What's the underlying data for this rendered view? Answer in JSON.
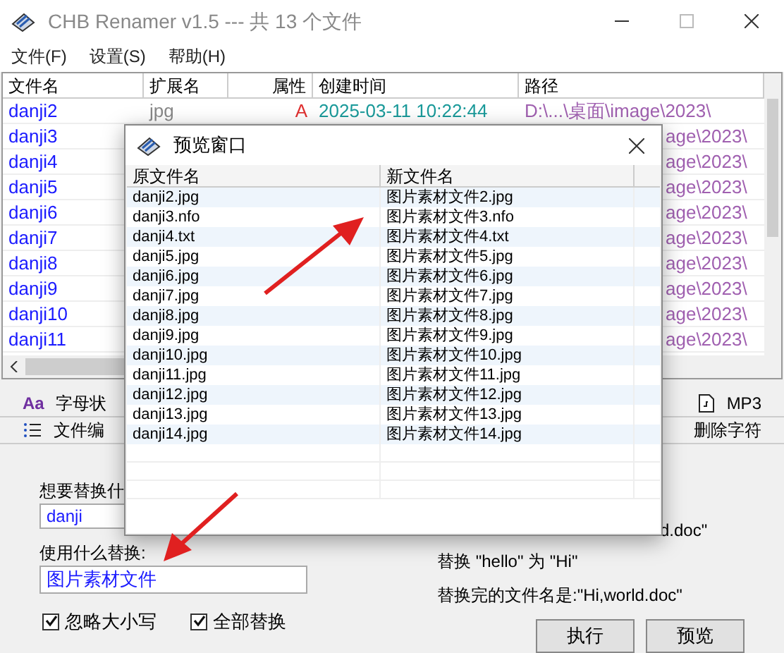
{
  "window": {
    "title": "CHB Renamer v1.5 --- 共 13 个文件"
  },
  "menu": [
    "文件(F)",
    "设置(S)",
    "帮助(H)"
  ],
  "file_list": {
    "columns": [
      "文件名",
      "扩展名",
      "属性",
      "创建时间",
      "路径"
    ],
    "rows": [
      {
        "name": "danji2",
        "ext": "jpg",
        "attr": "A",
        "created": "2025-03-11 10:22:44",
        "path": "D:\\...\\桌面\\image\\2023\\"
      },
      {
        "name": "danji3",
        "path": "age\\2023\\"
      },
      {
        "name": "danji4",
        "path": "age\\2023\\"
      },
      {
        "name": "danji5",
        "path": "age\\2023\\"
      },
      {
        "name": "danji6",
        "path": "age\\2023\\"
      },
      {
        "name": "danji7",
        "path": "age\\2023\\"
      },
      {
        "name": "danji8",
        "path": "age\\2023\\"
      },
      {
        "name": "danji9",
        "path": "age\\2023\\"
      },
      {
        "name": "danji10",
        "path": "age\\2023\\"
      },
      {
        "name": "danji11",
        "path": "age\\2023\\"
      }
    ]
  },
  "tabs_row1": [
    {
      "label": "字母状",
      "kind": "letters",
      "icon_text": "Aa",
      "selected": false
    },
    {
      "label": "MP3",
      "kind": "file",
      "selected": false
    }
  ],
  "tabs_row2": [
    {
      "label": "文件编",
      "kind": "list",
      "selected": false
    },
    {
      "label": "删除字符",
      "kind": "plain",
      "selected": false
    }
  ],
  "replace_panel": {
    "find_label": "想要替换什",
    "find_value": "danji",
    "replace_label": "使用什么替换:",
    "replace_value": "图片素材文件",
    "example_cut": "d.doc\"",
    "example_1": "替换 \"hello\" 为 \"Hi\"",
    "example_2": "替换完的文件名是:\"Hi,world.doc\"",
    "options": [
      {
        "label": "忽略大小写",
        "checked": true
      },
      {
        "label": "全部替换",
        "checked": true
      }
    ],
    "buttons": [
      "执行",
      "预览"
    ]
  },
  "preview_dialog": {
    "title": "预览窗口",
    "columns": [
      "原文件名",
      "新文件名"
    ],
    "rows": [
      [
        "danji2.jpg",
        "图片素材文件2.jpg"
      ],
      [
        "danji3.nfo",
        "图片素材文件3.nfo"
      ],
      [
        "danji4.txt",
        "图片素材文件4.txt"
      ],
      [
        "danji5.jpg",
        "图片素材文件5.jpg"
      ],
      [
        "danji6.jpg",
        "图片素材文件6.jpg"
      ],
      [
        "danji7.jpg",
        "图片素材文件7.jpg"
      ],
      [
        "danji8.jpg",
        "图片素材文件8.jpg"
      ],
      [
        "danji9.jpg",
        "图片素材文件9.jpg"
      ],
      [
        "danji10.jpg",
        "图片素材文件10.jpg"
      ],
      [
        "danji11.jpg",
        "图片素材文件11.jpg"
      ],
      [
        "danji12.jpg",
        "图片素材文件12.jpg"
      ],
      [
        "danji13.jpg",
        "图片素材文件13.jpg"
      ],
      [
        "danji14.jpg",
        "图片素材文件14.jpg"
      ]
    ]
  }
}
